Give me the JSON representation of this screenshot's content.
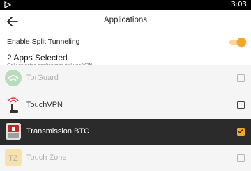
{
  "status_bar": {
    "time": "3:03"
  },
  "app_bar": {
    "title": "Applications"
  },
  "settings": {
    "split_tunneling_label": "Enable Split Tunneling",
    "split_tunneling_enabled": true,
    "apps_selected": "2 Apps Selected",
    "note": "Only selected applications will use VPN"
  },
  "apps": [
    {
      "name": "TorGuard",
      "checked": false,
      "icon": "torguard-icon"
    },
    {
      "name": "TouchVPN",
      "checked": false,
      "icon": "touchvpn-icon"
    },
    {
      "name": "Transmission BTC",
      "checked": true,
      "icon": "transmission-icon"
    },
    {
      "name": "Touch Zone",
      "checked": false,
      "icon": "touchzone-icon"
    }
  ],
  "colors": {
    "accent": "#f5a623",
    "selected_row": "#2b2b2b"
  }
}
